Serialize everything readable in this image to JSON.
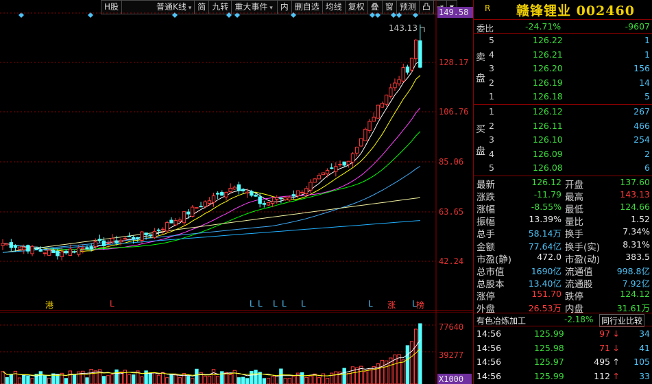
{
  "toolbar": {
    "items": [
      "H股",
      "普通K线",
      "简",
      "九转",
      "重大事件",
      "内",
      "删自选",
      "均线",
      "复权",
      "叠",
      "窗",
      "预测",
      "凸",
      "⇥"
    ]
  },
  "chart": {
    "price_labels": [
      "149.58",
      "128.17",
      "106.76",
      "85.06",
      "63.65",
      "42.24"
    ],
    "high_marker": "143.13",
    "event_marks": [
      {
        "text": "港",
        "color": "#f0d000"
      },
      {
        "text": "L",
        "color": "#ff3b3b"
      },
      {
        "text": "L",
        "color": "#4fc3f7"
      },
      {
        "text": "L",
        "color": "#4fc3f7"
      },
      {
        "text": "L",
        "color": "#4fc3f7"
      },
      {
        "text": "L",
        "color": "#4fc3f7"
      },
      {
        "text": "L",
        "color": "#4fc3f7"
      },
      {
        "text": "L",
        "color": "#4fc3f7"
      },
      {
        "text": "涨",
        "color": "#ff3b3b"
      },
      {
        "text": "L",
        "color": "#4fc3f7"
      },
      {
        "text": "榜",
        "color": "#ff3b3b"
      }
    ],
    "volume_labels": [
      "77640",
      "39277",
      "X1000"
    ]
  },
  "quote": {
    "badge": "R",
    "title": "赣锋锂业 002460",
    "weibi_label": "委比",
    "weibi_value": "-24.71%",
    "weicha_value": "-9607",
    "sell_label": [
      "卖",
      "盘"
    ],
    "buy_label": [
      "买",
      "盘"
    ],
    "sell": [
      {
        "n": "5",
        "price": "126.22",
        "vol": "1"
      },
      {
        "n": "4",
        "price": "126.21",
        "vol": "1"
      },
      {
        "n": "3",
        "price": "126.20",
        "vol": "156"
      },
      {
        "n": "2",
        "price": "126.19",
        "vol": "14"
      },
      {
        "n": "1",
        "price": "126.18",
        "vol": "5"
      }
    ],
    "buy": [
      {
        "n": "1",
        "price": "126.12",
        "vol": "267"
      },
      {
        "n": "2",
        "price": "126.11",
        "vol": "466"
      },
      {
        "n": "3",
        "price": "126.10",
        "vol": "254"
      },
      {
        "n": "4",
        "price": "126.09",
        "vol": "2"
      },
      {
        "n": "5",
        "price": "126.08",
        "vol": "6"
      }
    ],
    "stats": [
      {
        "l1": "最新",
        "v1": "126.12",
        "c1": "green",
        "l2": "开盘",
        "v2": "137.60",
        "c2": "green"
      },
      {
        "l1": "涨跌",
        "v1": "-11.79",
        "c1": "green",
        "l2": "最高",
        "v2": "143.13",
        "c2": "red"
      },
      {
        "l1": "涨幅",
        "v1": "-8.55%",
        "c1": "green",
        "l2": "最低",
        "v2": "124.66",
        "c2": "green"
      },
      {
        "l1": "振幅",
        "v1": "13.39%",
        "c1": "white",
        "l2": "量比",
        "v2": "1.52",
        "c2": "white"
      },
      {
        "l1": "总手",
        "v1": "58.14万",
        "c1": "cyan",
        "l2": "换手",
        "v2": "7.34%",
        "c2": "white"
      },
      {
        "l1": "金额",
        "v1": "77.64亿",
        "c1": "cyan",
        "l2": "换手(实)",
        "v2": "8.31%",
        "c2": "white"
      },
      {
        "l1": "市盈(静)",
        "v1": "472.0",
        "c1": "white",
        "l2": "市盈(动)",
        "v2": "383.5",
        "c2": "white"
      },
      {
        "l1": "总市值",
        "v1": "1690亿",
        "c1": "cyan",
        "l2": "流通值",
        "v2": "998.8亿",
        "c2": "cyan"
      },
      {
        "l1": "总股本",
        "v1": "13.40亿",
        "c1": "cyan",
        "l2": "流通股",
        "v2": "7.92亿",
        "c2": "cyan"
      },
      {
        "l1": "涨停",
        "v1": "151.70",
        "c1": "red",
        "l2": "跌停",
        "v2": "124.12",
        "c2": "green"
      },
      {
        "l1": "外盘",
        "v1": "26.53万",
        "c1": "red",
        "l2": "内盘",
        "v2": "31.61万",
        "c2": "green"
      }
    ],
    "industry_name": "有色冶炼加工",
    "industry_change": "-2.18%",
    "industry_compare": "同行业比较",
    "ticks": [
      {
        "time": "14:56",
        "price": "125.99",
        "vol": "97",
        "dir": "down",
        "count": "34"
      },
      {
        "time": "14:56",
        "price": "125.98",
        "vol": "71",
        "dir": "down",
        "count": "41"
      },
      {
        "time": "14:56",
        "price": "125.97",
        "vol": "495",
        "dir": "up",
        "count": "105"
      },
      {
        "time": "14:56",
        "price": "125.99",
        "vol": "112",
        "dir": "up",
        "count": "33"
      }
    ]
  },
  "colors": {
    "up": "#ff3b3b",
    "down": "#54ffff",
    "grid": "#8b0000"
  }
}
